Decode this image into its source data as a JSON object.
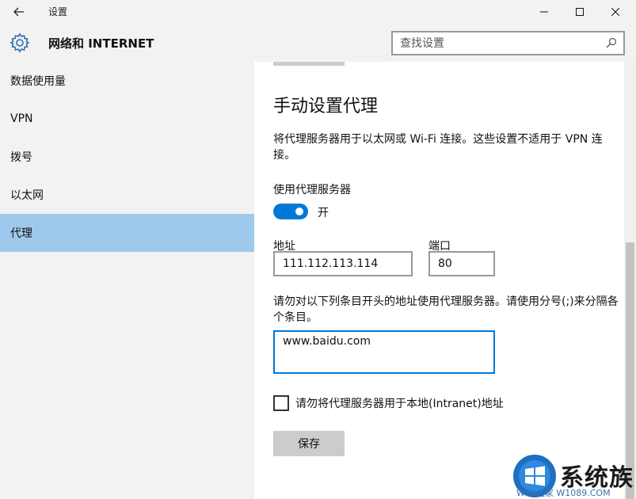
{
  "window": {
    "title": "设置"
  },
  "header": {
    "title": "网络和 INTERNET",
    "search_placeholder": "查找设置"
  },
  "sidebar": {
    "items": [
      {
        "label": "数据使用量"
      },
      {
        "label": "VPN"
      },
      {
        "label": "拨号"
      },
      {
        "label": "以太网"
      },
      {
        "label": "代理",
        "active": true
      }
    ]
  },
  "main": {
    "title": "手动设置代理",
    "description": "将代理服务器用于以太网或 Wi-Fi 连接。这些设置不适用于 VPN 连接。",
    "use_proxy_label": "使用代理服务器",
    "toggle": {
      "on": true,
      "state_text": "开"
    },
    "address_label": "地址",
    "address_value": "111.112.113.114",
    "port_label": "端口",
    "port_value": "80",
    "exceptions_description": "请勿对以下列条目开头的地址使用代理服务器。请使用分号(;)来分隔各个条目。",
    "exceptions_value": "www.baidu.com",
    "bypass_local_label": "请勿将代理服务器用于本地(Intranet)地址",
    "bypass_local_checked": false,
    "save_label": "保存"
  },
  "watermark": {
    "text": "系统族",
    "url": "W10之家 W1089.COM"
  },
  "colors": {
    "accent": "#0078d7",
    "active_item": "#9ec9ec",
    "sidebar_bg": "#f2f2f2"
  }
}
